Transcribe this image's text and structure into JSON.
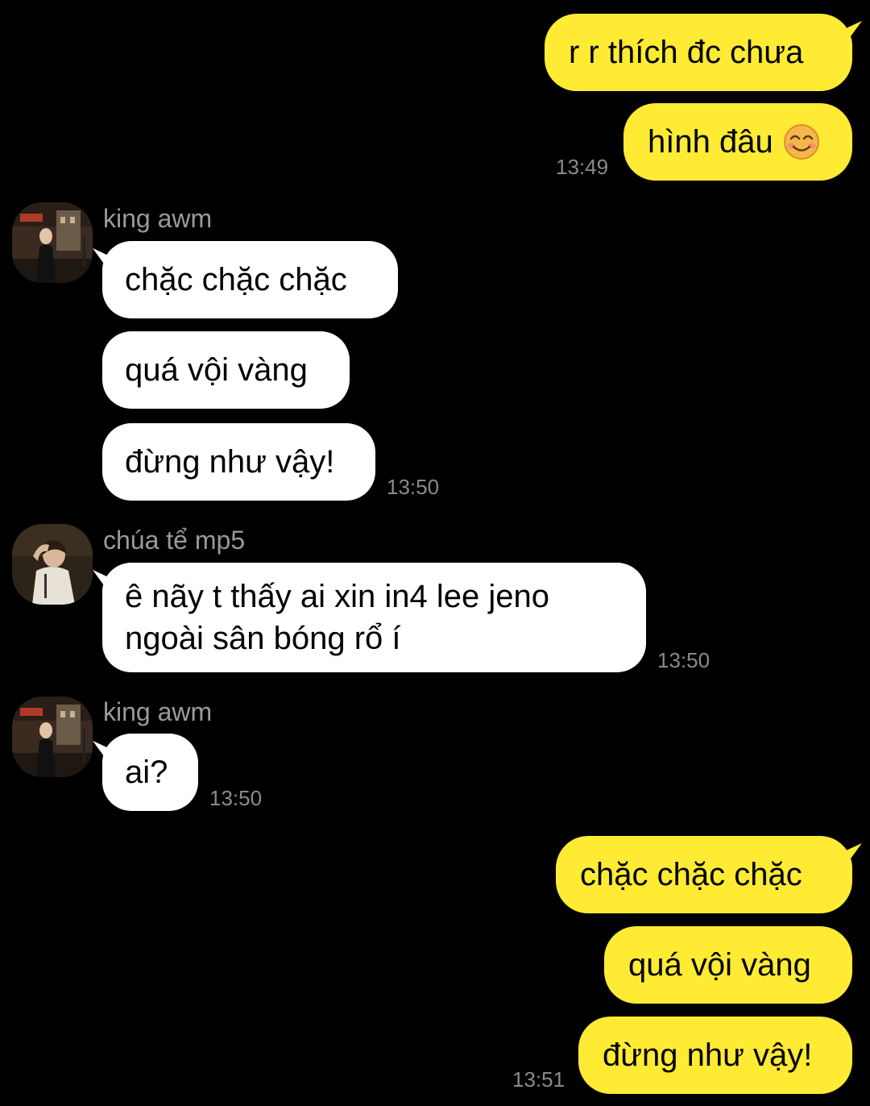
{
  "messages": {
    "m1": {
      "text": "r r thích đc chưa"
    },
    "m2": {
      "text": "hình đâu",
      "emoji": "smiling-face-with-smiling-eyes-icon",
      "time": "13:49"
    },
    "group1": {
      "sender": "king awm",
      "m3": "chặc chặc chặc",
      "m4": "quá vội vàng",
      "m5": "đừng như vậy!",
      "time": "13:50"
    },
    "group2": {
      "sender": "chúa tể mp5",
      "m6_line1": "ê nãy t thấy ai xin in4 lee jeno",
      "m6_line2": "ngoài sân bóng rổ í",
      "time": "13:50"
    },
    "group3": {
      "sender": "king awm",
      "m7": "ai?",
      "time": "13:50"
    },
    "m8": {
      "text": "chặc chặc chặc"
    },
    "m9": {
      "text": "quá vội vàng"
    },
    "m10": {
      "text": "đừng như vậy!",
      "time": "13:51"
    }
  },
  "colors": {
    "background": "#000000",
    "outgoing_bubble": "#FFEB33",
    "incoming_bubble": "#FFFFFF",
    "timestamp": "#8A8A8A",
    "sender_name": "#9A9A9A"
  }
}
